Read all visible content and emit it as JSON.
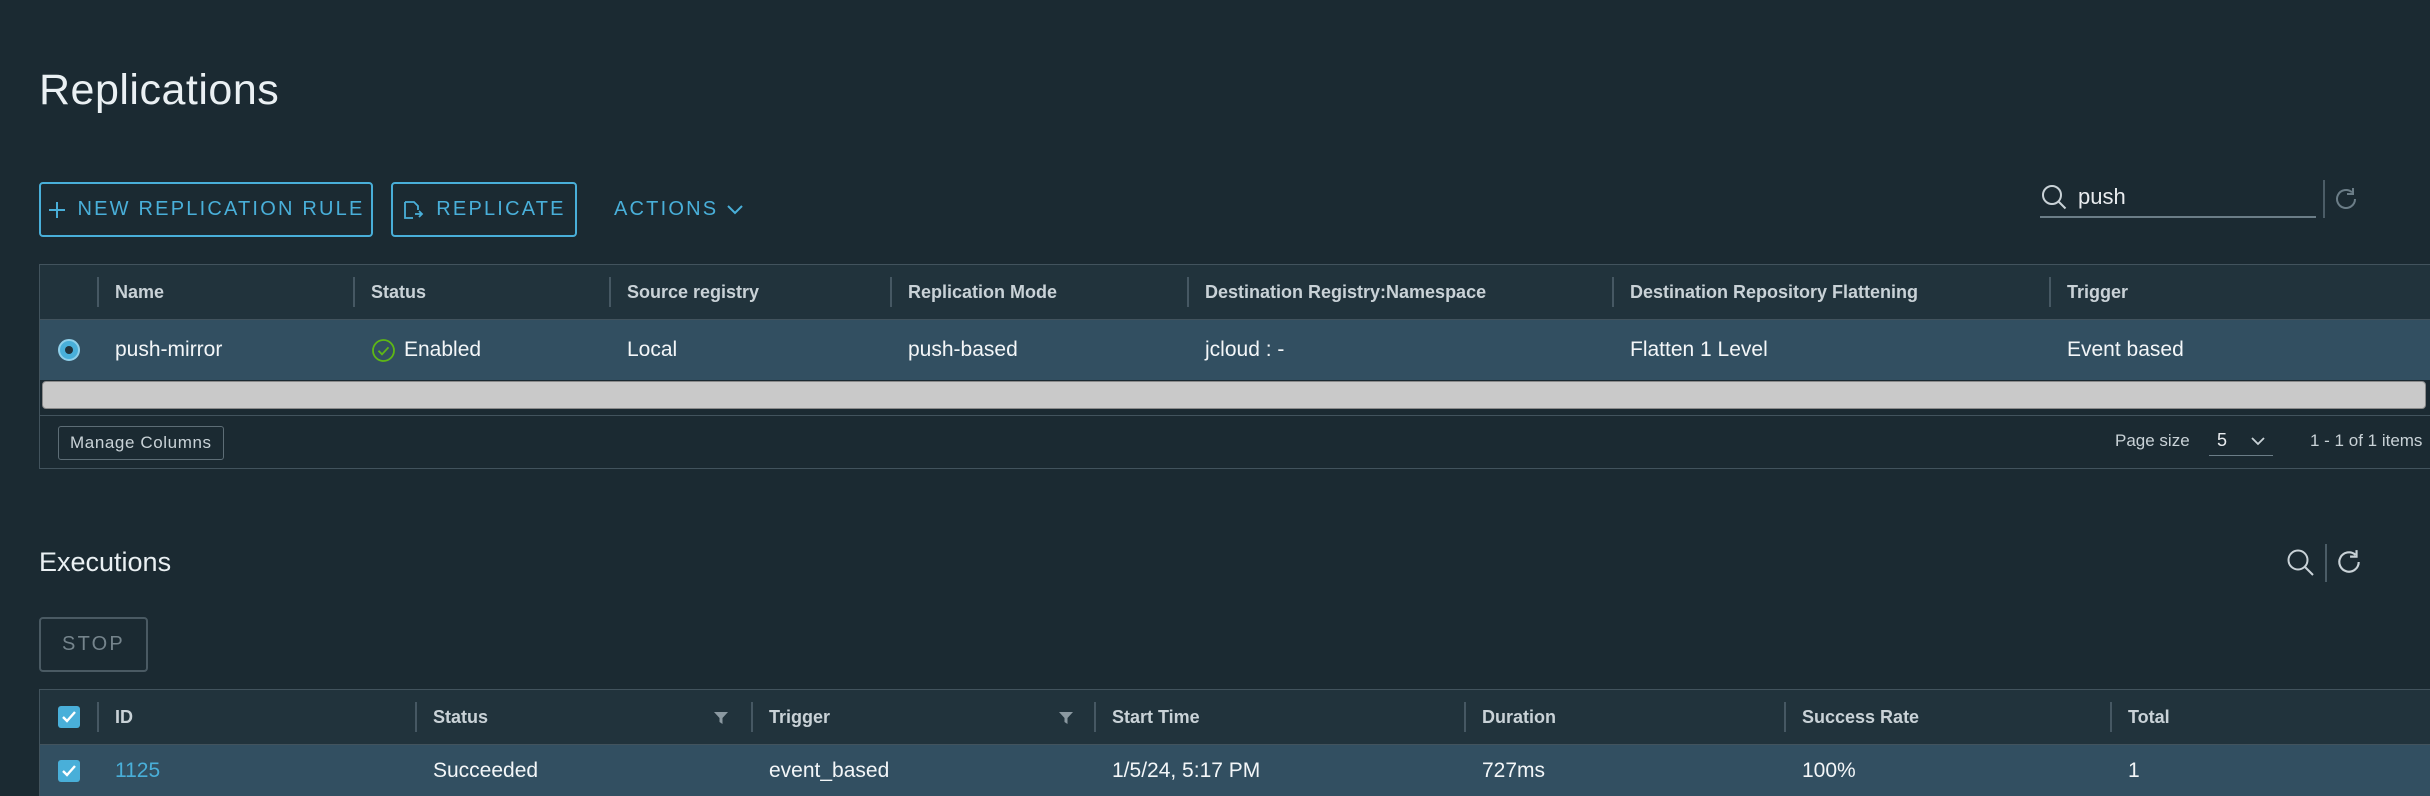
{
  "page": {
    "title": "Replications"
  },
  "toolbar": {
    "new_rule_label": "NEW REPLICATION RULE",
    "replicate_label": "REPLICATE",
    "actions_label": "ACTIONS",
    "search_value": "push"
  },
  "rules_grid": {
    "columns": [
      "Name",
      "Status",
      "Source registry",
      "Replication Mode",
      "Destination Registry:Namespace",
      "Destination Repository Flattening",
      "Trigger"
    ],
    "rows": [
      {
        "selected": true,
        "name": "push-mirror",
        "status": "Enabled",
        "source_registry": "Local",
        "replication_mode": "push-based",
        "destination": "jcloud : -",
        "flattening": "Flatten 1 Level",
        "trigger": "Event based"
      }
    ],
    "footer": {
      "manage_columns_label": "Manage Columns",
      "page_size_label": "Page size",
      "page_size_value": "5",
      "items_text": "1 - 1 of 1 items"
    }
  },
  "executions": {
    "title": "Executions",
    "stop_label": "STOP",
    "columns": [
      "ID",
      "Status",
      "Trigger",
      "Start Time",
      "Duration",
      "Success Rate",
      "Total"
    ],
    "rows": [
      {
        "selected": true,
        "id": "1125",
        "status": "Succeeded",
        "trigger": "event_based",
        "start_time": "1/5/24, 5:17 PM",
        "duration": "727ms",
        "success_rate": "100%",
        "total": "1"
      }
    ]
  },
  "colors": {
    "background": "#1b2a32",
    "accent": "#49afd9",
    "selected_row": "#324f61",
    "success": "#5eb715"
  }
}
